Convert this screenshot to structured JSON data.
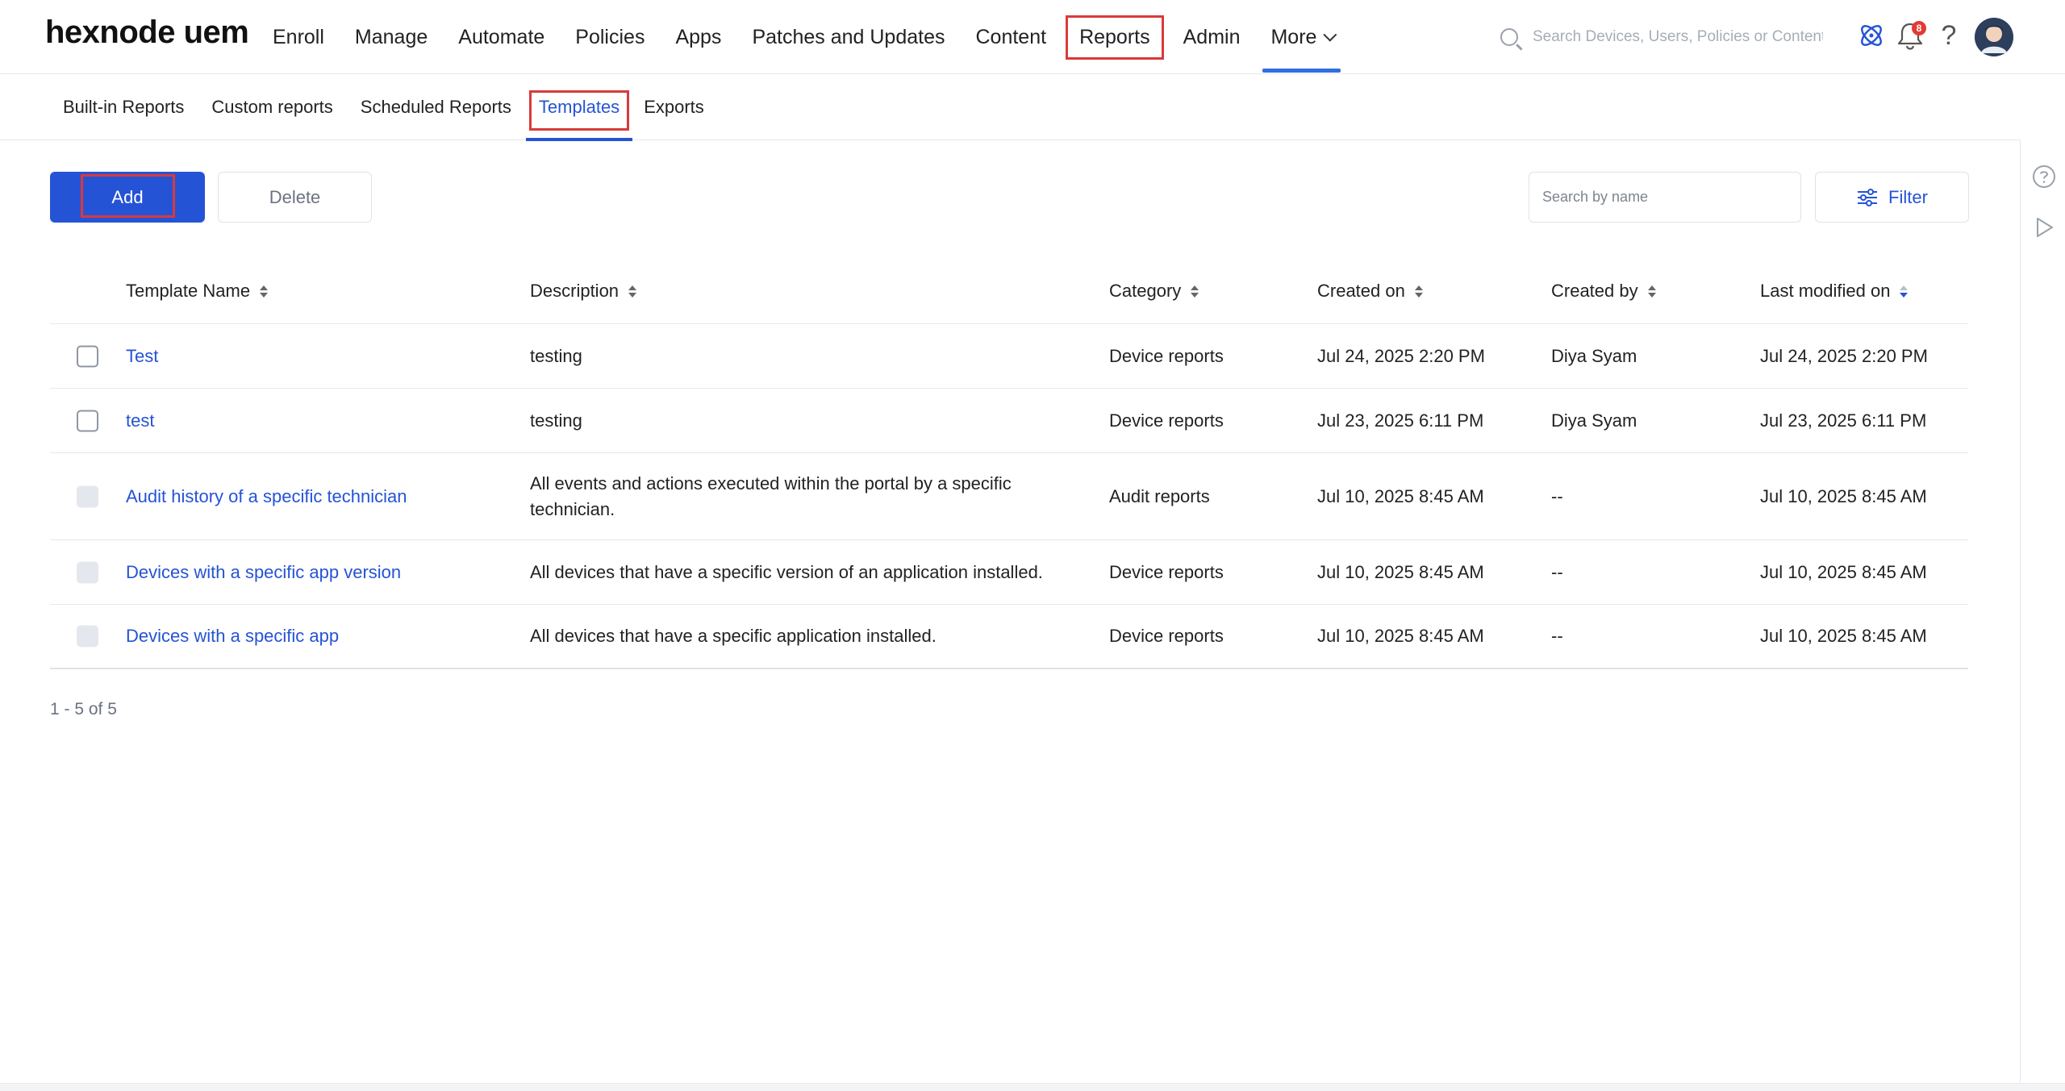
{
  "brand": {
    "logo_text": "hexnode uem"
  },
  "nav": {
    "items": [
      "Enroll",
      "Manage",
      "Automate",
      "Policies",
      "Apps",
      "Patches and Updates",
      "Content",
      "Reports",
      "Admin"
    ],
    "more_label": "More",
    "active": "Reports"
  },
  "search": {
    "placeholder": "Search Devices, Users, Policies or Content"
  },
  "notifications": {
    "count": "8"
  },
  "subnav": {
    "items": [
      "Built-in Reports",
      "Custom reports",
      "Scheduled Reports",
      "Templates",
      "Exports"
    ],
    "active": "Templates"
  },
  "toolbar": {
    "add_label": "Add",
    "delete_label": "Delete",
    "search_placeholder": "Search by name",
    "filter_label": "Filter"
  },
  "table": {
    "headers": {
      "name": "Template Name",
      "description": "Description",
      "category": "Category",
      "created_on": "Created on",
      "created_by": "Created by",
      "last_modified": "Last modified on"
    },
    "rows": [
      {
        "name": "Test",
        "description": "testing",
        "category": "Device reports",
        "created_on": "Jul 24, 2025 2:20 PM",
        "created_by": "Diya Syam",
        "last_modified": "Jul 24, 2025 2:20 PM"
      },
      {
        "name": "test",
        "description": "testing",
        "category": "Device reports",
        "created_on": "Jul 23, 2025 6:11 PM",
        "created_by": "Diya Syam",
        "last_modified": "Jul 23, 2025 6:11 PM"
      },
      {
        "name": "Audit history of a specific technician",
        "description": "All events and actions executed within the portal by a specific technician.",
        "category": "Audit reports",
        "created_on": "Jul 10, 2025 8:45 AM",
        "created_by": "--",
        "last_modified": "Jul 10, 2025 8:45 AM"
      },
      {
        "name": "Devices with a specific app version",
        "description": "All devices that have a specific version of an application installed.",
        "category": "Device reports",
        "created_on": "Jul 10, 2025 8:45 AM",
        "created_by": "--",
        "last_modified": "Jul 10, 2025 8:45 AM"
      },
      {
        "name": "Devices with a specific app",
        "description": "All devices that have a specific application installed.",
        "category": "Device reports",
        "created_on": "Jul 10, 2025 8:45 AM",
        "created_by": "--",
        "last_modified": "Jul 10, 2025 8:45 AM"
      }
    ]
  },
  "pagination": {
    "text": "1 - 5 of 5"
  },
  "colors": {
    "accent": "#2553d6",
    "highlight_box": "#d93a3a",
    "tab_underline": "#2f6fe0"
  }
}
